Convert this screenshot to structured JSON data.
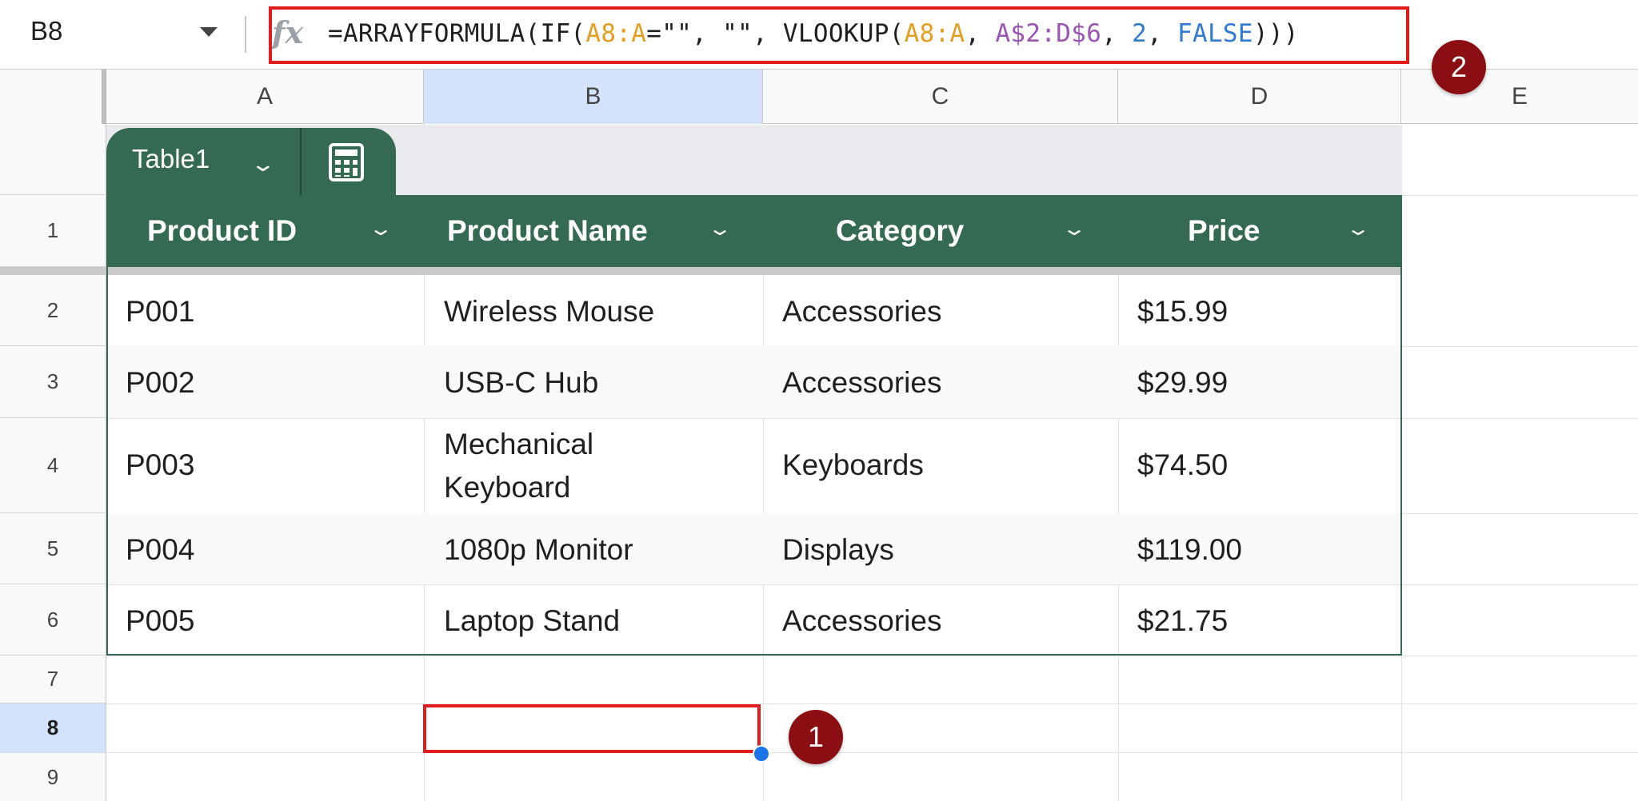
{
  "formula_bar": {
    "name_box": "B8",
    "fx_label": "fx",
    "formula_parts": [
      {
        "text": "=ARRAYFORMULA(IF(",
        "color": "default"
      },
      {
        "text": "A8:A",
        "color": "orange"
      },
      {
        "text": "=\"\", \"\", VLOOKUP(",
        "color": "default"
      },
      {
        "text": "A8:A",
        "color": "orange"
      },
      {
        "text": ", ",
        "color": "default"
      },
      {
        "text": "A$2:D$6",
        "color": "purple"
      },
      {
        "text": ", ",
        "color": "default"
      },
      {
        "text": "2",
        "color": "blue"
      },
      {
        "text": ", ",
        "color": "default"
      },
      {
        "text": "FALSE",
        "color": "blue"
      },
      {
        "text": ")))",
        "color": "default"
      }
    ]
  },
  "columns": [
    "A",
    "B",
    "C",
    "D",
    "E"
  ],
  "rows": [
    "1",
    "2",
    "3",
    "4",
    "5",
    "6",
    "7",
    "8",
    "9"
  ],
  "table": {
    "name": "Table1",
    "chevron": "⌄",
    "headers": [
      "Product ID",
      "Product Name",
      "Category",
      "Price"
    ],
    "data": [
      [
        "P001",
        "Wireless Mouse",
        "Accessories",
        "$15.99"
      ],
      [
        "P002",
        "USB-C Hub",
        "Accessories",
        "$29.99"
      ],
      [
        "P003",
        "Mechanical Keyboard",
        "Keyboards",
        "$74.50"
      ],
      [
        "P004",
        "1080p Monitor",
        "Displays",
        "$119.00"
      ],
      [
        "P005",
        "Laptop Stand",
        "Accessories",
        "$21.75"
      ]
    ]
  },
  "selection": {
    "active_cell": "B8"
  },
  "callouts": [
    "1",
    "2"
  ],
  "colors": {
    "table_green": "#346a52",
    "highlight_red": "#e01c1c",
    "badge_red": "#8b0e12",
    "selection_blue": "#d3e3fd"
  }
}
